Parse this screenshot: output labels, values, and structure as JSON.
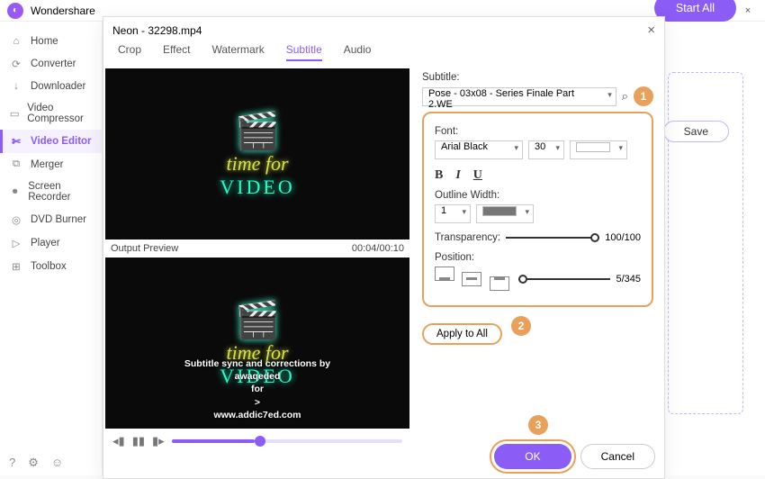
{
  "app": {
    "title": "Wondershare"
  },
  "window_controls": {
    "menu": "≡",
    "min": "—",
    "max": "□",
    "close": "×"
  },
  "sidebar": {
    "items": [
      {
        "label": "Home",
        "icon": "⌂"
      },
      {
        "label": "Converter",
        "icon": "⟳"
      },
      {
        "label": "Downloader",
        "icon": "↓"
      },
      {
        "label": "Video Compressor",
        "icon": "▭"
      },
      {
        "label": "Video Editor",
        "icon": "✄"
      },
      {
        "label": "Merger",
        "icon": "⧉"
      },
      {
        "label": "Screen Recorder",
        "icon": "⏺"
      },
      {
        "label": "DVD Burner",
        "icon": "◎"
      },
      {
        "label": "Player",
        "icon": "▷"
      },
      {
        "label": "Toolbox",
        "icon": "⊞"
      }
    ],
    "bottom": {
      "help": "?",
      "settings": "⚙",
      "user": "☺"
    }
  },
  "dialog": {
    "title": "Neon - 32298.mp4",
    "close": "×",
    "tabs": [
      "Crop",
      "Effect",
      "Watermark",
      "Subtitle",
      "Audio"
    ],
    "preview_label": "Output Preview",
    "timecode": "00:04/00:10",
    "neon": {
      "line1": "time for",
      "line2": "VIDEO"
    },
    "subtitle_overlay": {
      "l1": "Subtitle sync and corrections by",
      "l2": "awaqeded",
      "l3": "for",
      "l4": ">",
      "l5": "www.addic7ed.com"
    },
    "panel": {
      "subtitle_label": "Subtitle:",
      "subtitle_value": "Pose - 03x08 - Series Finale Part 2.WE",
      "font_label": "Font:",
      "font_name": "Arial Black",
      "font_size": "30",
      "bold": "B",
      "italic": "I",
      "underline": "U",
      "outline_label": "Outline Width:",
      "outline_value": "1",
      "transparency_label": "Transparency:",
      "transparency_value": "100/100",
      "position_label": "Position:",
      "position_value": "5/345",
      "apply_all": "Apply to All"
    },
    "markers": {
      "m1": "1",
      "m2": "2",
      "m3": "3"
    },
    "ok": "OK",
    "cancel": "Cancel"
  },
  "page": {
    "save": "Save",
    "start_all": "Start All"
  }
}
